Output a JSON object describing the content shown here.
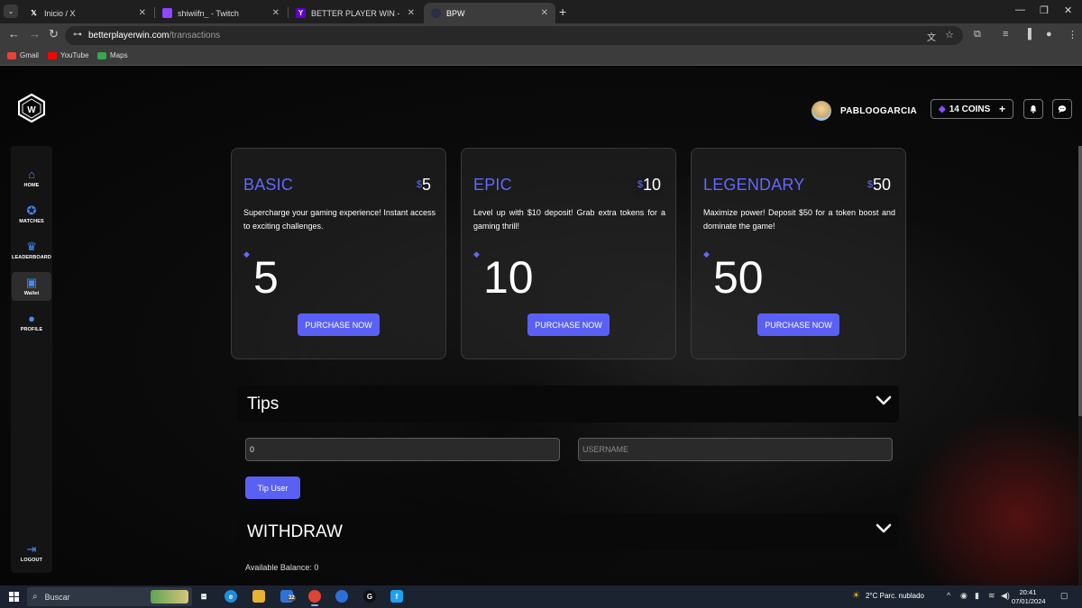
{
  "browser": {
    "tabs": [
      {
        "title": "Inicio / X",
        "icon": "x-logo-icon"
      },
      {
        "title": "shiwiifn_ - Twitch",
        "icon": "twitch-icon"
      },
      {
        "title": "BETTER PLAYER WIN - Resultad",
        "icon": "yahoo-icon"
      },
      {
        "title": "BPW",
        "icon": "bpw-icon"
      }
    ],
    "url_host": "betterplayerwin.com",
    "url_path": "/transactions",
    "bookmarks": [
      "Gmail",
      "YouTube",
      "Maps"
    ]
  },
  "header": {
    "username": "PABLOOGARCIA",
    "coins": "14 COINS",
    "coins_plus": "+"
  },
  "sidebar": {
    "items": [
      {
        "label": "HOME",
        "icon": "home-icon"
      },
      {
        "label": "MATCHES",
        "icon": "controller-icon"
      },
      {
        "label": "LEADERBOARD",
        "icon": "trophy-icon"
      },
      {
        "label": "Wallet",
        "icon": "wallet-icon"
      },
      {
        "label": "PROFILE",
        "icon": "user-icon"
      }
    ],
    "logout": "LOGOUT"
  },
  "cards": [
    {
      "name": "BASIC",
      "price": "5",
      "description": "Supercharge your gaming experience! Instant access to exciting challenges.",
      "amount": "5",
      "button": "PURCHASE NOW"
    },
    {
      "name": "EPIC",
      "price": "10",
      "description": "Level up with $10 deposit! Grab extra tokens for a gaming thrill!",
      "amount": "10",
      "button": "PURCHASE NOW"
    },
    {
      "name": "LEGENDARY",
      "price": "50",
      "description": "Maximize power! Deposit $50 for a token boost and dominate the game!",
      "amount": "50",
      "button": "PURCHASE NOW"
    }
  ],
  "currency_symbol": "$",
  "tips": {
    "title": "Tips",
    "amount_value": "0",
    "username_placeholder": "USERNAME",
    "button": "Tip User"
  },
  "withdraw": {
    "title": "WITHDRAW",
    "balance": "Available Balance: 0"
  },
  "taskbar": {
    "search": "Buscar",
    "mail_badge": "32",
    "weather": "2°C  Parc. nublado",
    "time": "20:41",
    "date": "07/01/2024"
  },
  "colors": {
    "accent": "#5b60f5",
    "brand_text": "#6269ff",
    "coin_gem": "#8c4cff",
    "sidebar_icon": "#3f8cff"
  }
}
